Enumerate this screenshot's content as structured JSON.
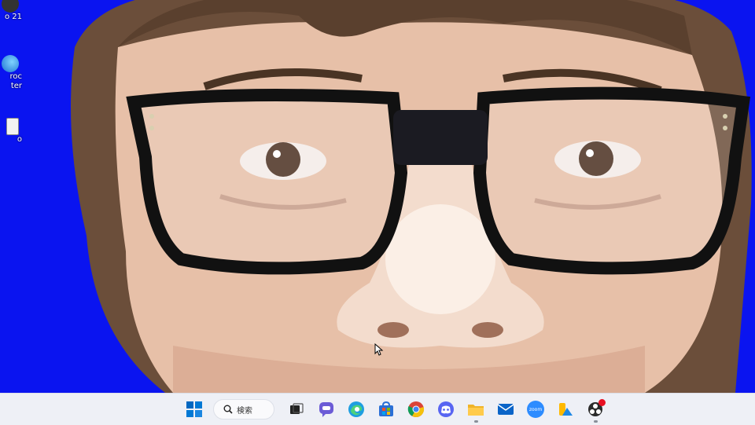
{
  "desktop": {
    "icons": [
      {
        "label": "o 21",
        "icon": "app-icon"
      },
      {
        "label": "roc\nter",
        "icon": "app-icon"
      },
      {
        "label": "o",
        "icon": "document-icon"
      }
    ]
  },
  "taskbar": {
    "search_label": "検索",
    "apps": [
      {
        "name": "start-button",
        "icon": "windows-logo-icon"
      },
      {
        "name": "search",
        "icon": "search-icon"
      },
      {
        "name": "task-view",
        "icon": "task-view-icon"
      },
      {
        "name": "chat",
        "icon": "chat-icon"
      },
      {
        "name": "edge",
        "icon": "edge-icon"
      },
      {
        "name": "store",
        "icon": "store-icon"
      },
      {
        "name": "chrome",
        "icon": "chrome-icon"
      },
      {
        "name": "discord",
        "icon": "discord-icon"
      },
      {
        "name": "file-explorer",
        "icon": "folder-icon"
      },
      {
        "name": "mail",
        "icon": "mail-icon"
      },
      {
        "name": "zoom",
        "icon": "zoom-icon"
      },
      {
        "name": "photos",
        "icon": "photos-icon"
      },
      {
        "name": "obs",
        "icon": "obs-icon"
      }
    ],
    "zoom_label": "zoom"
  },
  "colors": {
    "desktop_background": "#0a14f0",
    "taskbar_background": "#eef0f6",
    "accent": "#0067c0"
  }
}
